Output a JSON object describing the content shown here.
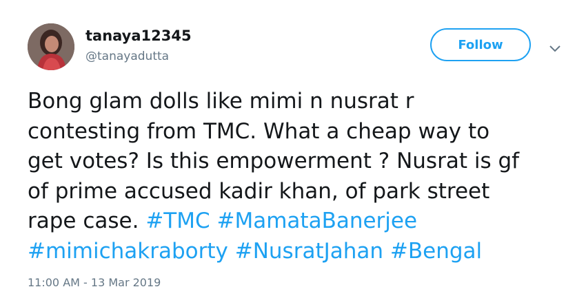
{
  "user": {
    "display_name": "tanaya12345",
    "handle": "@tanayadutta",
    "avatar_icon": "profile-photo"
  },
  "header": {
    "follow_label": "Follow",
    "caret_icon": "chevron-down-icon"
  },
  "tweet": {
    "lines": [
      "Bong glam dolls like mimi n nusrat r",
      "contesting from TMC. What a cheap way to",
      "get votes? Is this empowerment ? Nusrat is gf",
      "of prime accused kadir khan, of park street",
      "rape case. "
    ],
    "hashtags_line5": [
      "#TMC",
      "#MamataBanerjee"
    ],
    "hashtags_line6": [
      "#mimichakraborty",
      "#NusratJahan",
      "#Bengal"
    ],
    "timestamp": "11:00 AM - 13 Mar 2019"
  },
  "colors": {
    "link": "#1da1f2",
    "text": "#14171a",
    "muted": "#657786"
  }
}
